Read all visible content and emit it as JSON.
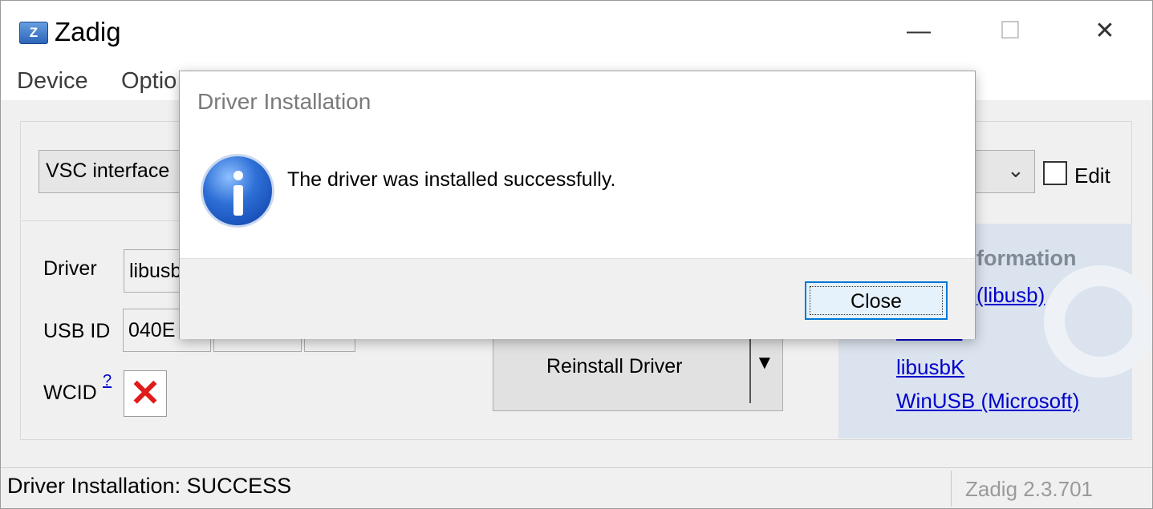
{
  "window": {
    "title": "Zadig",
    "icon_letter": "Z",
    "controls": {
      "minimize": "—",
      "maximize": "☐",
      "close": "✕"
    }
  },
  "menu": {
    "items": [
      "Device",
      "Optio"
    ]
  },
  "device_select": {
    "value": "VSC interface",
    "edit_label": "Edit"
  },
  "form": {
    "driver_label": "Driver",
    "driver_value": "libusb",
    "usbid_label": "USB ID",
    "usbid_values": [
      "040E",
      "",
      ""
    ],
    "wcid_label": "WCID",
    "wcid_help": "?",
    "wcid_mark": "✕"
  },
  "reinstall_button": {
    "label": "Reinstall Driver",
    "arrow": "▼"
  },
  "info_panel": {
    "heading": "More Information",
    "links": [
      "(libusb)",
      "-Win32",
      "libusbK",
      "WinUSB (Microsoft)"
    ]
  },
  "status_bar": {
    "text": "Driver Installation: SUCCESS",
    "version": "Zadig 2.3.701"
  },
  "dialog": {
    "title": "Driver Installation",
    "message": "The driver was installed successfully.",
    "close_label": "Close"
  },
  "colors": {
    "link": "#0000cc",
    "error_mark": "#e01b1b",
    "focus_border": "#0078d7"
  }
}
